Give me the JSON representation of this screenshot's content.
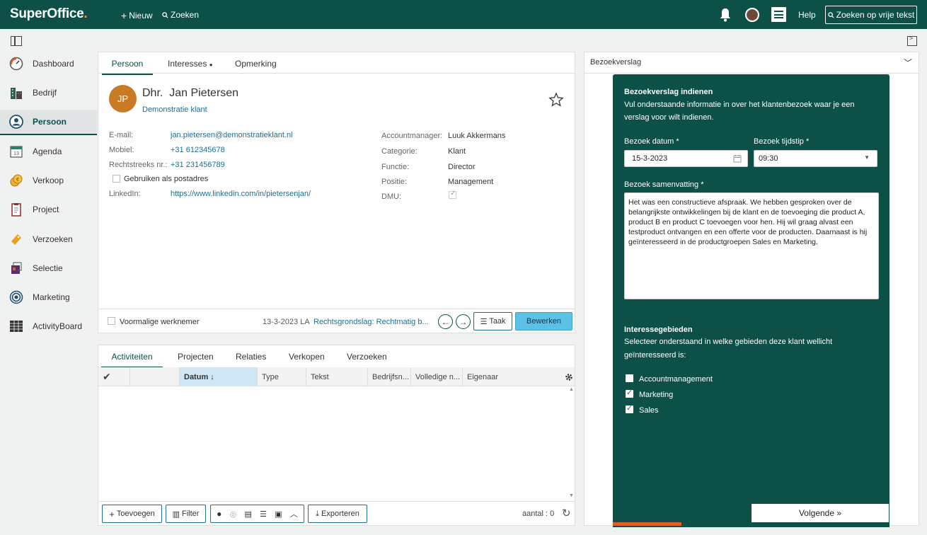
{
  "topbar": {
    "logo": "SuperOffice",
    "logo_dot": ".",
    "new_label": "Nieuw",
    "search_label": "Zoeken",
    "help_label": "Help",
    "freetext_label": "Zoeken op vrije tekst",
    "brand_color": "#0d5047"
  },
  "sidebar": {
    "items": [
      {
        "label": "Dashboard",
        "icon": "dashboard-icon"
      },
      {
        "label": "Bedrijf",
        "icon": "company-icon"
      },
      {
        "label": "Persoon",
        "icon": "person-icon",
        "active": true
      },
      {
        "label": "Agenda",
        "icon": "calendar-icon"
      },
      {
        "label": "Verkoop",
        "icon": "sale-icon"
      },
      {
        "label": "Project",
        "icon": "project-icon"
      },
      {
        "label": "Verzoeken",
        "icon": "request-icon"
      },
      {
        "label": "Selectie",
        "icon": "selection-icon"
      },
      {
        "label": "Marketing",
        "icon": "marketing-icon"
      },
      {
        "label": "ActivityBoard",
        "icon": "activityboard-icon"
      }
    ]
  },
  "person": {
    "tabs": [
      "Persoon",
      "Interesses",
      "Opmerking"
    ],
    "interests_dot": "●",
    "initials": "JP",
    "name": "Dhr.  Jan Pietersen",
    "company": "Demonstratie klant",
    "fields_left": [
      {
        "label": "E-mail:",
        "value": "jan.pietersen@demonstratieklant.nl"
      },
      {
        "label": "Mobiel:",
        "value": "+31 612345678"
      },
      {
        "label": "Rechtstreeks nr.:",
        "value": "+31 231456789"
      },
      {
        "label": "LinkedIn:",
        "value": "https://www.linkedin.com/in/pietersenjan/"
      }
    ],
    "postal_label": "Gebruiken als postadres",
    "fields_right": [
      {
        "label": "Accountmanager:",
        "value": "Luuk Akkermans"
      },
      {
        "label": "Categorie:",
        "value": "Klant"
      },
      {
        "label": "Functie:",
        "value": "Director"
      },
      {
        "label": "Positie:",
        "value": "Management"
      },
      {
        "label": "DMU:",
        "value": ""
      }
    ],
    "former_employee": "Voormalige werknemer",
    "updated": "13-3-2023 LA",
    "legal_basis": "Rechtsgrondslag: Rechtmatig b...",
    "task_label": "Taak",
    "edit_label": "Bewerken"
  },
  "activities": {
    "tabs": [
      "Activiteiten",
      "Projecten",
      "Relaties",
      "Verkopen",
      "Verzoeken"
    ],
    "columns": [
      "Datum",
      "Type",
      "Tekst",
      "Bedrijfsn...",
      "Volledige n...",
      "Eigenaar"
    ],
    "sort_indicator": "↓",
    "add_label": "Toevoegen",
    "filter_label": "Filter",
    "export_label": "Exporteren",
    "count_label": "aantal : 0"
  },
  "report": {
    "panel_title": "Bezoekverslag",
    "form_title": "Bezoekverslag indienen",
    "intro_1": "Vul onderstaande informatie in over het klantenbezoek waar je een",
    "intro_2": "verslag voor wilt indienen.",
    "date_label": "Bezoek datum *",
    "date_value": "15-3-2023",
    "time_label": "Bezoek tijdstip *",
    "time_value": "09:30",
    "summary_label": "Bezoek samenvatting *",
    "summary_value": "Het was een constructieve afspraak. We hebben gesproken over de belangrijkste ontwikkelingen bij de klant en de toevoeging die product A, product B en product C toevoegen voor hen. Hij wil graag alvast een testproduct ontvangen en een offerte voor de producten. Daarnaast is hij geïnteresseerd in de productgroepen Sales en Marketing.",
    "interests_title": "Interessegebieden",
    "interests_intro_1": "Selecteer onderstaand in welke gebieden deze klant wellicht",
    "interests_intro_2": "geïnteresseerd is:",
    "options": [
      {
        "label": "Accountmanagement",
        "checked": false
      },
      {
        "label": "Marketing",
        "checked": true
      },
      {
        "label": "Sales",
        "checked": true
      }
    ],
    "next_label": "Volgende »",
    "accent_color": "#e35b25"
  }
}
